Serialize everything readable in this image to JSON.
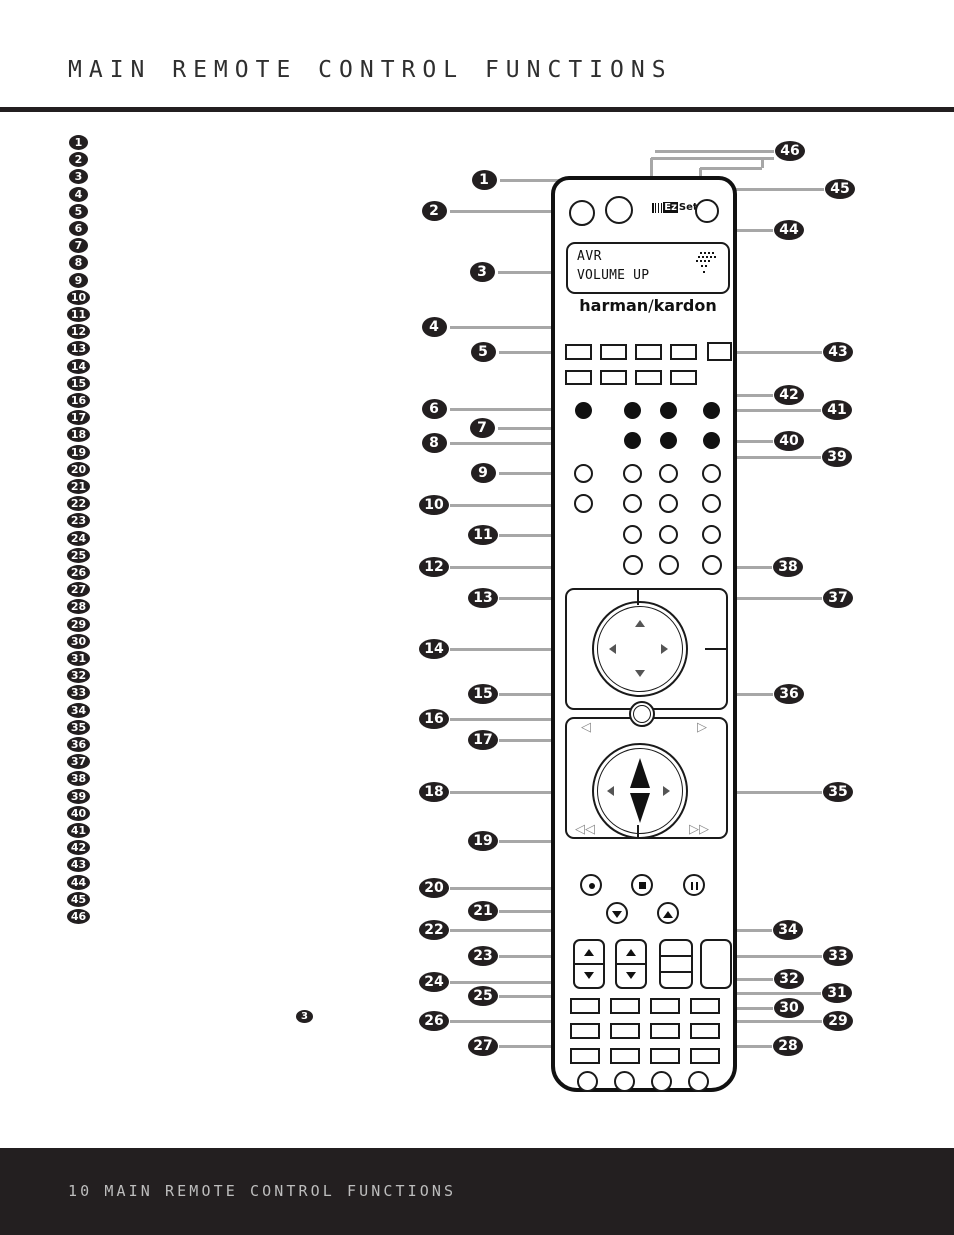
{
  "header": {
    "title": "MAIN REMOTE CONTROL FUNCTIONS"
  },
  "footer": {
    "page_number": "10",
    "title": "MAIN REMOTE CONTROL FUNCTIONS",
    "text": "10  MAIN REMOTE CONTROL FUNCTIONS"
  },
  "legend_list": {
    "items": [
      "1",
      "2",
      "3",
      "4",
      "5",
      "6",
      "7",
      "8",
      "9",
      "10",
      "11",
      "12",
      "13",
      "14",
      "15",
      "16",
      "17",
      "18",
      "19",
      "20",
      "21",
      "22",
      "23",
      "24",
      "25",
      "26",
      "27",
      "28",
      "29",
      "30",
      "31",
      "32",
      "33",
      "34",
      "35",
      "36",
      "37",
      "38",
      "39",
      "40",
      "41",
      "42",
      "43",
      "44",
      "45",
      "46"
    ]
  },
  "stray_marker": {
    "label": "3"
  },
  "remote": {
    "brand": "harman/kardon",
    "brand_left": "harman",
    "brand_slash": "/",
    "brand_right": "kardon",
    "ezset_label": "EzSet",
    "ezset_prefix": "Ez",
    "ezset_suffix": "Set",
    "display": {
      "line1": "AVR",
      "line2": "VOLUME UP",
      "signal_icon": "signal-dots-icon"
    },
    "transport": {
      "record_icon": "record-icon",
      "stop_icon": "stop-icon",
      "pause_icon": "pause-icon",
      "down_icon": "triangle-down-icon",
      "up_icon": "triangle-up-icon"
    },
    "navigation": {
      "up_icon": "arrow-up-icon",
      "down_icon": "arrow-down-icon",
      "left_icon": "arrow-left-icon",
      "right_icon": "arrow-right-icon",
      "prev_icon": "prev-track-icon",
      "next_icon": "next-track-icon",
      "rewind_icon": "rewind-icon",
      "fast_forward_icon": "fast-forward-icon",
      "rewind_label": "◁◁",
      "forward_label": "▷▷",
      "left_label": "◁",
      "right_label": "▷"
    }
  },
  "callouts": {
    "left": [
      "1",
      "2",
      "3",
      "4",
      "5",
      "6",
      "7",
      "8",
      "9",
      "10",
      "11",
      "12",
      "13",
      "14",
      "15",
      "16",
      "17",
      "18",
      "19",
      "20",
      "21",
      "22",
      "23",
      "24",
      "25",
      "26",
      "27"
    ],
    "right": [
      "28",
      "29",
      "30",
      "31",
      "32",
      "33",
      "34",
      "35",
      "36",
      "37",
      "38",
      "39",
      "40",
      "41",
      "42",
      "43",
      "44",
      "45",
      "46"
    ]
  },
  "colors": {
    "ink": "#231f20",
    "leader": "#a7a7a7",
    "footer_bg": "#231f20",
    "footer_text": "#bdbdbd",
    "paper": "#ffffff"
  }
}
